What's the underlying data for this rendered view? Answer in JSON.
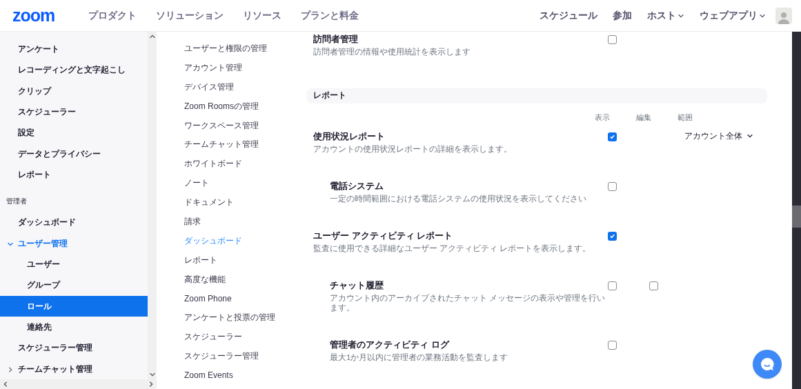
{
  "header": {
    "logo": "zoom",
    "nav": [
      "プロダクト",
      "ソリューション",
      "リソース",
      "プランと料金"
    ],
    "right_nav": [
      {
        "label": "スケジュール",
        "dropdown": false
      },
      {
        "label": "参加",
        "dropdown": false
      },
      {
        "label": "ホスト",
        "dropdown": true
      },
      {
        "label": "ウェブアプリ",
        "dropdown": true
      }
    ]
  },
  "sidebar": {
    "items": [
      {
        "label": "アンケート",
        "selected": false
      },
      {
        "label": "レコーディングと文字起こし",
        "selected": false
      },
      {
        "label": "クリップ",
        "selected": false
      },
      {
        "label": "スケジューラー",
        "selected": false
      },
      {
        "label": "設定",
        "selected": false
      },
      {
        "label": "データとプライバシー",
        "selected": false
      },
      {
        "label": "レポート",
        "selected": false
      }
    ],
    "section": "管理者",
    "admin_items": [
      {
        "label": "ダッシュボード",
        "selected": false
      },
      {
        "label": "ユーザー管理",
        "selected": false,
        "expanded": true,
        "children": [
          {
            "label": "ユーザー",
            "selected": false
          },
          {
            "label": "グループ",
            "selected": false
          },
          {
            "label": "ロール",
            "selected": true
          },
          {
            "label": "連絡先",
            "selected": false
          }
        ]
      },
      {
        "label": "スケジューラー管理",
        "selected": false
      },
      {
        "label": "チームチャット管理",
        "selected": false,
        "expanded": false
      }
    ]
  },
  "subnav": {
    "items": [
      {
        "label": "ユーザーと権限の管理",
        "selected": false
      },
      {
        "label": "アカウント管理",
        "selected": false
      },
      {
        "label": "デバイス管理",
        "selected": false
      },
      {
        "label": "Zoom Roomsの管理",
        "selected": false
      },
      {
        "label": "ワークスペース管理",
        "selected": false
      },
      {
        "label": "チームチャット管理",
        "selected": false
      },
      {
        "label": "ホワイトボード",
        "selected": false
      },
      {
        "label": "ノート",
        "selected": false
      },
      {
        "label": "ドキュメント",
        "selected": false
      },
      {
        "label": "請求",
        "selected": false
      },
      {
        "label": "ダッシュボード",
        "selected": true
      },
      {
        "label": "レポート",
        "selected": false
      },
      {
        "label": "高度な機能",
        "selected": false
      },
      {
        "label": "Zoom Phone",
        "selected": false
      },
      {
        "label": "アンケートと投票の管理",
        "selected": false
      },
      {
        "label": "スケジューラー",
        "selected": false
      },
      {
        "label": "スケジューラー管理",
        "selected": false
      },
      {
        "label": "Zoom Events",
        "selected": false
      }
    ]
  },
  "content": {
    "top_row": {
      "title": "訪問者管理",
      "description": "訪問者管理の情報や使用統計を表示します",
      "view": {
        "checked": false
      }
    },
    "section": {
      "title": "レポート",
      "columns": [
        "表示",
        "編集",
        "範囲"
      ],
      "rows": [
        {
          "title": "使用状況レポート",
          "description": "アカウントの使用状況レポートの詳細を表示します。",
          "view": {
            "checked": true
          },
          "scope": "アカウント全体",
          "children": [
            {
              "title": "電話システム",
              "description": "一定の時間範囲における電話システムの使用状況を表示してください",
              "view": {
                "checked": false
              }
            }
          ]
        },
        {
          "title": "ユーザー アクティビティ レポート",
          "description": "監査に使用できる詳細なユーザー アクティビティ レポートを表示します。",
          "view": {
            "checked": true
          },
          "children": [
            {
              "title": "チャット履歴",
              "description": "アカウント内のアーカイブされたチャット メッセージの表示や管理を行います。",
              "view": {
                "checked": false
              },
              "edit": {
                "checked": false
              }
            },
            {
              "title": "管理者のアクティビティ ログ",
              "description": "最大1か月以内に管理者の業務活動を監査します",
              "view": {
                "checked": false
              }
            }
          ]
        }
      ]
    }
  }
}
